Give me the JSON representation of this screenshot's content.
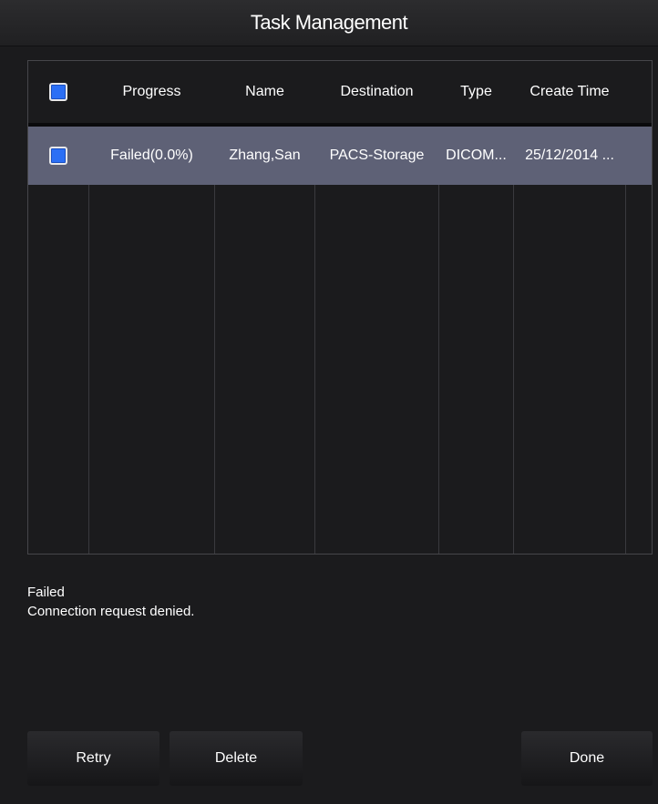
{
  "window": {
    "title": "Task Management"
  },
  "table": {
    "columns": [
      "",
      "Progress",
      "Name",
      "Destination",
      "Type",
      "Create Time"
    ],
    "header_checkbox": {
      "checked": true
    },
    "rows": [
      {
        "selected": true,
        "checked": true,
        "progress": "Failed(0.0%)",
        "name": "Zhang,San",
        "destination": "PACS-Storage",
        "type": "DICOM...",
        "create_time": "25/12/2014 ..."
      }
    ]
  },
  "status": {
    "line1": "Failed",
    "line2": "Connection request denied."
  },
  "buttons": {
    "retry": "Retry",
    "delete": "Delete",
    "done": "Done"
  },
  "colors": {
    "background": "#1b1b1d",
    "selected_row": "#5e6176",
    "checkbox_fill": "#2b6ff5"
  }
}
